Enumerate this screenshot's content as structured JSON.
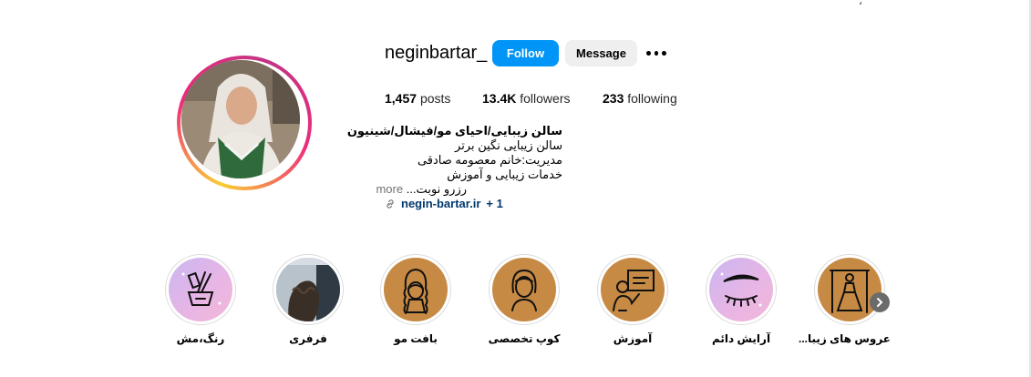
{
  "profile": {
    "username": "neginbartar_",
    "follow_label": "Follow",
    "message_label": "Message",
    "stats": {
      "posts_count": "1,457",
      "posts_label": "posts",
      "followers_count": "13.4K",
      "followers_label": "followers",
      "following_count": "233",
      "following_label": "following"
    },
    "bio": {
      "name": "سالن زیبایی/احیای مو/فیشال/شینیون",
      "lines": [
        "سالن زیبایی نگین برتر",
        "مدیریت:خانم معصومه صادقی",
        "خدمات زیبایی و آموزش",
        "رزرو نوبت..."
      ],
      "more_label": "more",
      "link_text": "negin-bartar.ir",
      "link_extra": "+ 1"
    }
  },
  "highlights": [
    {
      "label": "رنگ،مش",
      "icon": "hair-dye-tools-icon"
    },
    {
      "label": "فرفری",
      "icon": "curly-hair-photo"
    },
    {
      "label": "بافت مو",
      "icon": "braided-hair-icon"
    },
    {
      "label": "کوپ تخصصی",
      "icon": "haircut-woman-icon"
    },
    {
      "label": "آموزش",
      "icon": "teaching-board-icon"
    },
    {
      "label": "آرایش دائم",
      "icon": "eyebrow-eyelash-icon"
    },
    {
      "label": "عروس های زیبا...",
      "icon": "bride-dress-icon"
    }
  ],
  "colors": {
    "follow_button": "#0095f6",
    "link": "#00376b",
    "highlight_tan": "#c68a45"
  }
}
